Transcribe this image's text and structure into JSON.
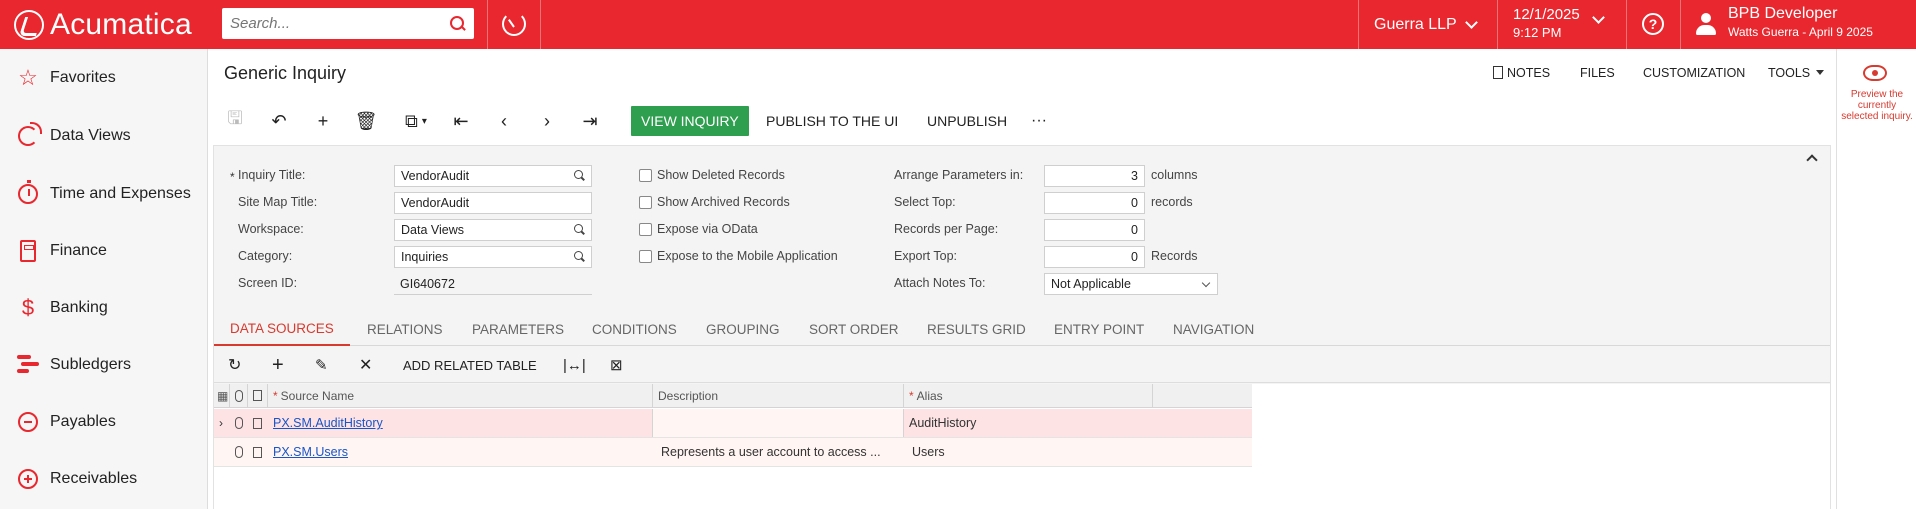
{
  "brand": {
    "name": "Acumatica",
    "accent": "#e8272e"
  },
  "header": {
    "search_placeholder": "Search...",
    "company": "Guerra LLP",
    "date": "12/1/2025",
    "time": "9:12 PM",
    "user_name": "BPB Developer",
    "user_sub": "Watts Guerra - April 9 2025"
  },
  "sidebar": {
    "items": [
      {
        "label": "Favorites",
        "icon": "star-icon"
      },
      {
        "label": "Data Views",
        "icon": "pie-chart-icon"
      },
      {
        "label": "Time and Expenses",
        "icon": "stopwatch-icon"
      },
      {
        "label": "Finance",
        "icon": "calculator-icon"
      },
      {
        "label": "Banking",
        "icon": "dollar-icon"
      },
      {
        "label": "Subledgers",
        "icon": "bars-icon"
      },
      {
        "label": "Payables",
        "icon": "minus-circle-icon"
      },
      {
        "label": "Receivables",
        "icon": "plus-circle-icon"
      }
    ]
  },
  "page": {
    "title": "Generic Inquiry",
    "links": {
      "notes": "NOTES",
      "files": "FILES",
      "customization": "CUSTOMIZATION",
      "tools": "TOOLS"
    }
  },
  "toolbar": {
    "view_inquiry": "VIEW INQUIRY",
    "publish": "PUBLISH TO THE UI",
    "unpublish": "UNPUBLISH",
    "more": "···"
  },
  "form": {
    "inquiry_title_label": "Inquiry Title:",
    "inquiry_title": "VendorAudit",
    "site_map_title_label": "Site Map Title:",
    "site_map_title": "VendorAudit",
    "workspace_label": "Workspace:",
    "workspace": "Data Views",
    "category_label": "Category:",
    "category": "Inquiries",
    "screen_id_label": "Screen ID:",
    "screen_id": "GI640672",
    "show_deleted": "Show Deleted Records",
    "show_archived": "Show Archived Records",
    "expose_odata": "Expose via OData",
    "expose_mobile": "Expose to the Mobile Application",
    "arrange_label": "Arrange Parameters in:",
    "arrange_value": "3",
    "arrange_unit": "columns",
    "select_top_label": "Select Top:",
    "select_top": "0",
    "select_top_unit": "records",
    "rpp_label": "Records per Page:",
    "rpp": "0",
    "export_top_label": "Export Top:",
    "export_top": "0",
    "export_top_unit": "Records",
    "attach_notes_label": "Attach Notes To:",
    "attach_notes": "Not Applicable"
  },
  "tabs": [
    "DATA SOURCES",
    "RELATIONS",
    "PARAMETERS",
    "CONDITIONS",
    "GROUPING",
    "SORT ORDER",
    "RESULTS GRID",
    "ENTRY POINT",
    "NAVIGATION"
  ],
  "grid_toolbar": {
    "add_related": "ADD RELATED TABLE"
  },
  "grid": {
    "columns": [
      "Source Name",
      "Description",
      "Alias"
    ],
    "rows": [
      {
        "source": "PX.SM.AuditHistory",
        "description": "",
        "alias": "AuditHistory"
      },
      {
        "source": "PX.SM.Users",
        "description": "Represents a user account to access ...",
        "alias": "Users"
      }
    ]
  },
  "right_panel": {
    "tooltip": "Preview the currently selected inquiry."
  }
}
